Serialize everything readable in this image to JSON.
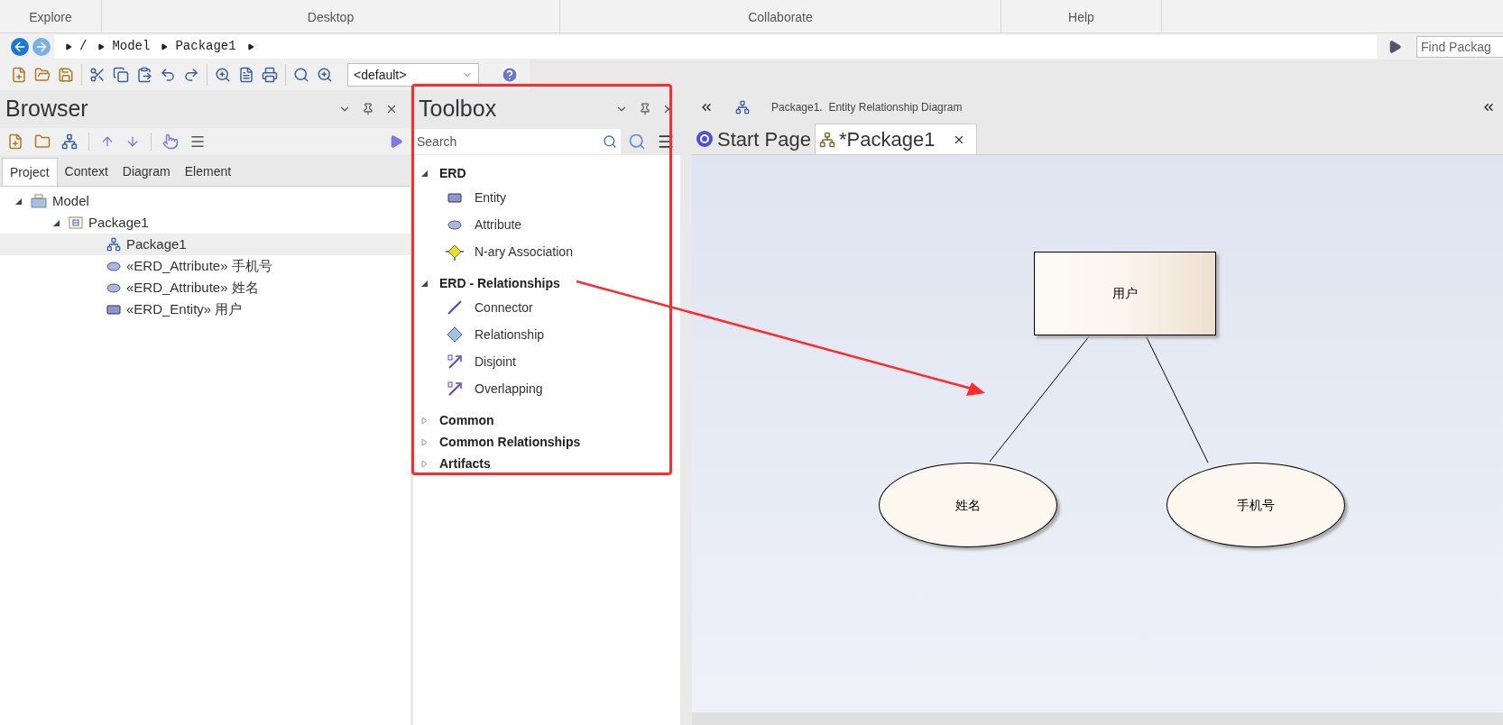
{
  "ribbon": {
    "groups": [
      "Explore",
      "Desktop",
      "Collaborate",
      "Help"
    ]
  },
  "breadcrumb": {
    "items": [
      "/",
      "Model",
      "Package1"
    ],
    "find_placeholder": "Find Packag"
  },
  "toolbar": {
    "view_select": "<default>"
  },
  "browser": {
    "title": "Browser",
    "tabs": [
      {
        "label": "Project",
        "selected": true
      },
      {
        "label": "Context",
        "selected": false
      },
      {
        "label": "Diagram",
        "selected": false
      },
      {
        "label": "Element",
        "selected": false
      }
    ],
    "tree": [
      {
        "label": "Model",
        "kind": "model",
        "selected": false,
        "expanded": true,
        "children": [
          {
            "label": "Package1",
            "kind": "package",
            "selected": false,
            "expanded": true,
            "children": [
              {
                "label": "Package1",
                "kind": "diagram",
                "selected": true
              },
              {
                "label": "«ERD_Attribute» 手机号",
                "kind": "attribute",
                "selected": false
              },
              {
                "label": "«ERD_Attribute» 姓名",
                "kind": "attribute",
                "selected": false
              },
              {
                "label": "«ERD_Entity» 用户",
                "kind": "entity",
                "selected": false
              }
            ]
          }
        ]
      }
    ]
  },
  "toolbox": {
    "title": "Toolbox",
    "search_placeholder": "Search",
    "groups": [
      {
        "label": "ERD",
        "expanded": true,
        "items": [
          {
            "label": "Entity",
            "kind": "entity"
          },
          {
            "label": "Attribute",
            "kind": "attribute"
          },
          {
            "label": "N-ary Association",
            "kind": "association"
          }
        ]
      },
      {
        "label": "ERD - Relationships",
        "expanded": true,
        "items": [
          {
            "label": "Connector",
            "kind": "connector"
          },
          {
            "label": "Relationship",
            "kind": "relationship"
          },
          {
            "label": "Disjoint",
            "kind": "disjoint"
          },
          {
            "label": "Overlapping",
            "kind": "overlapping"
          }
        ]
      },
      {
        "label": "Common",
        "expanded": false
      },
      {
        "label": "Common Relationships",
        "expanded": false
      },
      {
        "label": "Artifacts",
        "expanded": false
      }
    ]
  },
  "diagram": {
    "header": "Package1.  Entity Relationship Diagram",
    "tabs": [
      {
        "label": "Start Page",
        "kind": "start",
        "selected": false
      },
      {
        "label": "*Package1",
        "kind": "diagram",
        "selected": true
      }
    ],
    "nodes": [
      {
        "kind": "entity",
        "label": "用户"
      },
      {
        "kind": "attribute",
        "label": "姓名"
      },
      {
        "kind": "attribute",
        "label": "手机号"
      }
    ]
  }
}
